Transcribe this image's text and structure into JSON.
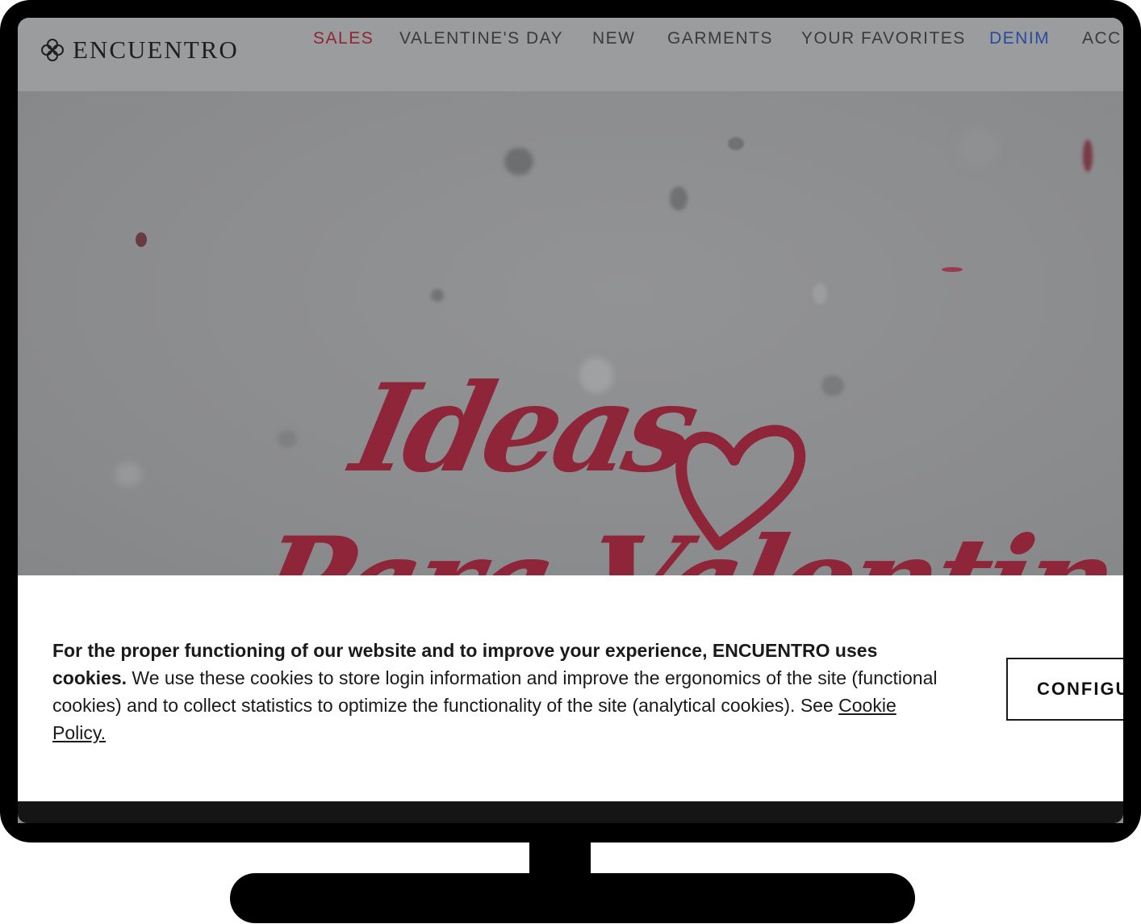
{
  "header": {
    "logo_text": "ENCUENTRO",
    "nav": [
      {
        "label": "SALES",
        "color": "#8e2538"
      },
      {
        "label": "VALENTINE'S DAY",
        "color": "#3a3a3c"
      },
      {
        "label": "NEW",
        "color": "#3a3a3c"
      },
      {
        "label": "GARMENTS",
        "color": "#3a3a3c"
      },
      {
        "label": "YOUR FAVORITES",
        "color": "#3a3a3c"
      },
      {
        "label": "DENIM",
        "color": "#2a4aa0"
      },
      {
        "label": "ACC",
        "color": "#3a3a3c"
      }
    ]
  },
  "hero": {
    "line1": "Ideas",
    "line2": "Para Valentin",
    "accent_color": "#8e2538"
  },
  "cookie_banner": {
    "text_bold": "For the proper functioning of our website and to improve your experience, ENCUENTRO uses cookies.",
    "text_rest": " We use these cookies to store login information and improve the ergonomics of the site (functional cookies) and to collect statistics to optimize the functionality of the site (analytical cookies). See ",
    "policy_link": "Cookie Policy.",
    "config_button": "CONFIGURE"
  }
}
